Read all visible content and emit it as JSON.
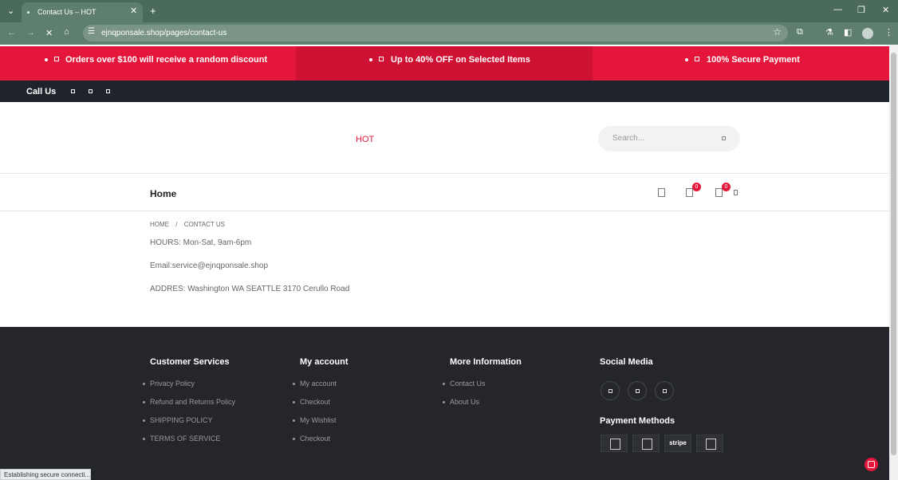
{
  "browser": {
    "tab_title": "Contact Us – HOT",
    "url": "ejnqponsale.shop/pages/contact-us",
    "status": "Establishing secure connecti..."
  },
  "promo": {
    "items": [
      "Orders over $100 will receive a random discount",
      "Up to 40% OFF on Selected Items",
      "100% Secure Payment"
    ],
    "color": "#e5163c"
  },
  "topbar": {
    "call": "Call Us"
  },
  "header": {
    "brand": "HOT",
    "search_placeholder": "Search...",
    "nav_home": "Home",
    "wishlist_count": "0",
    "cart_count": "0"
  },
  "breadcrumb": {
    "home": "HOME",
    "sep": "/",
    "current": "CONTACT US"
  },
  "contact": {
    "hours": "HOURS: Mon-Sat, 9am-6pm",
    "email": "Email:service@ejnqponsale.shop",
    "address": "ADDRES: Washington WA SEATTLE 3170 Cerullo Road"
  },
  "footer": {
    "customer_services": {
      "heading": "Customer Services",
      "links": [
        "Privacy Policy",
        "Refund and Returns Policy",
        "SHIPPING POLICY",
        "TERMS OF SERVICE"
      ]
    },
    "my_account": {
      "heading": "My account",
      "links": [
        "My account",
        "Checkout",
        "My Wishlist",
        "Checkout"
      ]
    },
    "more_info": {
      "heading": "More Information",
      "links": [
        "Contact Us",
        "About Us"
      ]
    },
    "social": {
      "heading": "Social Media"
    },
    "payment": {
      "heading": "Payment Methods",
      "stripe": "stripe"
    }
  }
}
